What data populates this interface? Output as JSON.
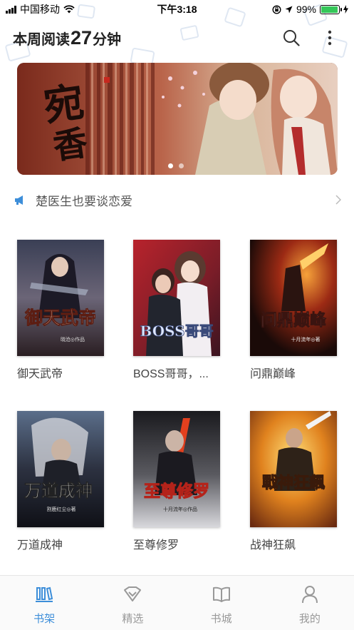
{
  "status_bar": {
    "carrier": "中国移动",
    "time": "下午3:18",
    "battery": "99%",
    "battery_level": 0.99
  },
  "header": {
    "title_prefix": "本周阅读",
    "minutes": "27",
    "title_suffix": "分钟",
    "icons": [
      "search-icon",
      "more-icon"
    ]
  },
  "banner": {
    "calligraphy": "宛香",
    "slide_count": 2,
    "active_slide": 1
  },
  "notice": {
    "text": "楚医生也要谈恋爱",
    "icon": "megaphone-icon",
    "accent": "#3d8ed9"
  },
  "books": [
    {
      "title": "御天武帝",
      "cover_text": "御天武帝",
      "author_credit": "晓沧◎作品"
    },
    {
      "title": "BOSS哥哥，...",
      "cover_text": "BOSS哥哥",
      "author_credit": ""
    },
    {
      "title": "问鼎巅峰",
      "cover_text": "问鼎巅峰",
      "author_credit": "十月流年◎著"
    },
    {
      "title": "万道成神",
      "cover_text": "万道成神",
      "author_credit": "割鹿红尘◎著"
    },
    {
      "title": "至尊修罗",
      "cover_text": "至尊修罗",
      "author_credit": "十月流年◎作品"
    },
    {
      "title": "战神狂飙",
      "cover_text": "戰神狂飆",
      "author_credit": ""
    }
  ],
  "tabbar": {
    "active_color": "#3d8ed9",
    "tabs": [
      {
        "label": "书架",
        "icon": "bookshelf-icon",
        "active": true
      },
      {
        "label": "精选",
        "icon": "featured-icon",
        "active": false
      },
      {
        "label": "书城",
        "icon": "bookstore-icon",
        "active": false
      },
      {
        "label": "我的",
        "icon": "profile-icon",
        "active": false
      }
    ]
  }
}
